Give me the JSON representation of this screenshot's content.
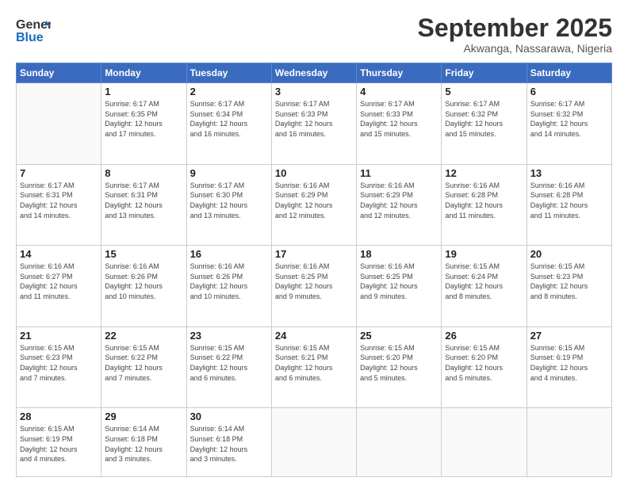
{
  "logo": {
    "line1": "General",
    "line2": "Blue"
  },
  "header": {
    "month": "September 2025",
    "location": "Akwanga, Nassarawa, Nigeria"
  },
  "weekdays": [
    "Sunday",
    "Monday",
    "Tuesday",
    "Wednesday",
    "Thursday",
    "Friday",
    "Saturday"
  ],
  "weeks": [
    [
      {
        "day": "",
        "info": ""
      },
      {
        "day": "1",
        "info": "Sunrise: 6:17 AM\nSunset: 6:35 PM\nDaylight: 12 hours\nand 17 minutes."
      },
      {
        "day": "2",
        "info": "Sunrise: 6:17 AM\nSunset: 6:34 PM\nDaylight: 12 hours\nand 16 minutes."
      },
      {
        "day": "3",
        "info": "Sunrise: 6:17 AM\nSunset: 6:33 PM\nDaylight: 12 hours\nand 16 minutes."
      },
      {
        "day": "4",
        "info": "Sunrise: 6:17 AM\nSunset: 6:33 PM\nDaylight: 12 hours\nand 15 minutes."
      },
      {
        "day": "5",
        "info": "Sunrise: 6:17 AM\nSunset: 6:32 PM\nDaylight: 12 hours\nand 15 minutes."
      },
      {
        "day": "6",
        "info": "Sunrise: 6:17 AM\nSunset: 6:32 PM\nDaylight: 12 hours\nand 14 minutes."
      }
    ],
    [
      {
        "day": "7",
        "info": "Sunrise: 6:17 AM\nSunset: 6:31 PM\nDaylight: 12 hours\nand 14 minutes."
      },
      {
        "day": "8",
        "info": "Sunrise: 6:17 AM\nSunset: 6:31 PM\nDaylight: 12 hours\nand 13 minutes."
      },
      {
        "day": "9",
        "info": "Sunrise: 6:17 AM\nSunset: 6:30 PM\nDaylight: 12 hours\nand 13 minutes."
      },
      {
        "day": "10",
        "info": "Sunrise: 6:16 AM\nSunset: 6:29 PM\nDaylight: 12 hours\nand 12 minutes."
      },
      {
        "day": "11",
        "info": "Sunrise: 6:16 AM\nSunset: 6:29 PM\nDaylight: 12 hours\nand 12 minutes."
      },
      {
        "day": "12",
        "info": "Sunrise: 6:16 AM\nSunset: 6:28 PM\nDaylight: 12 hours\nand 11 minutes."
      },
      {
        "day": "13",
        "info": "Sunrise: 6:16 AM\nSunset: 6:28 PM\nDaylight: 12 hours\nand 11 minutes."
      }
    ],
    [
      {
        "day": "14",
        "info": "Sunrise: 6:16 AM\nSunset: 6:27 PM\nDaylight: 12 hours\nand 11 minutes."
      },
      {
        "day": "15",
        "info": "Sunrise: 6:16 AM\nSunset: 6:26 PM\nDaylight: 12 hours\nand 10 minutes."
      },
      {
        "day": "16",
        "info": "Sunrise: 6:16 AM\nSunset: 6:26 PM\nDaylight: 12 hours\nand 10 minutes."
      },
      {
        "day": "17",
        "info": "Sunrise: 6:16 AM\nSunset: 6:25 PM\nDaylight: 12 hours\nand 9 minutes."
      },
      {
        "day": "18",
        "info": "Sunrise: 6:16 AM\nSunset: 6:25 PM\nDaylight: 12 hours\nand 9 minutes."
      },
      {
        "day": "19",
        "info": "Sunrise: 6:15 AM\nSunset: 6:24 PM\nDaylight: 12 hours\nand 8 minutes."
      },
      {
        "day": "20",
        "info": "Sunrise: 6:15 AM\nSunset: 6:23 PM\nDaylight: 12 hours\nand 8 minutes."
      }
    ],
    [
      {
        "day": "21",
        "info": "Sunrise: 6:15 AM\nSunset: 6:23 PM\nDaylight: 12 hours\nand 7 minutes."
      },
      {
        "day": "22",
        "info": "Sunrise: 6:15 AM\nSunset: 6:22 PM\nDaylight: 12 hours\nand 7 minutes."
      },
      {
        "day": "23",
        "info": "Sunrise: 6:15 AM\nSunset: 6:22 PM\nDaylight: 12 hours\nand 6 minutes."
      },
      {
        "day": "24",
        "info": "Sunrise: 6:15 AM\nSunset: 6:21 PM\nDaylight: 12 hours\nand 6 minutes."
      },
      {
        "day": "25",
        "info": "Sunrise: 6:15 AM\nSunset: 6:20 PM\nDaylight: 12 hours\nand 5 minutes."
      },
      {
        "day": "26",
        "info": "Sunrise: 6:15 AM\nSunset: 6:20 PM\nDaylight: 12 hours\nand 5 minutes."
      },
      {
        "day": "27",
        "info": "Sunrise: 6:15 AM\nSunset: 6:19 PM\nDaylight: 12 hours\nand 4 minutes."
      }
    ],
    [
      {
        "day": "28",
        "info": "Sunrise: 6:15 AM\nSunset: 6:19 PM\nDaylight: 12 hours\nand 4 minutes."
      },
      {
        "day": "29",
        "info": "Sunrise: 6:14 AM\nSunset: 6:18 PM\nDaylight: 12 hours\nand 3 minutes."
      },
      {
        "day": "30",
        "info": "Sunrise: 6:14 AM\nSunset: 6:18 PM\nDaylight: 12 hours\nand 3 minutes."
      },
      {
        "day": "",
        "info": ""
      },
      {
        "day": "",
        "info": ""
      },
      {
        "day": "",
        "info": ""
      },
      {
        "day": "",
        "info": ""
      }
    ]
  ]
}
